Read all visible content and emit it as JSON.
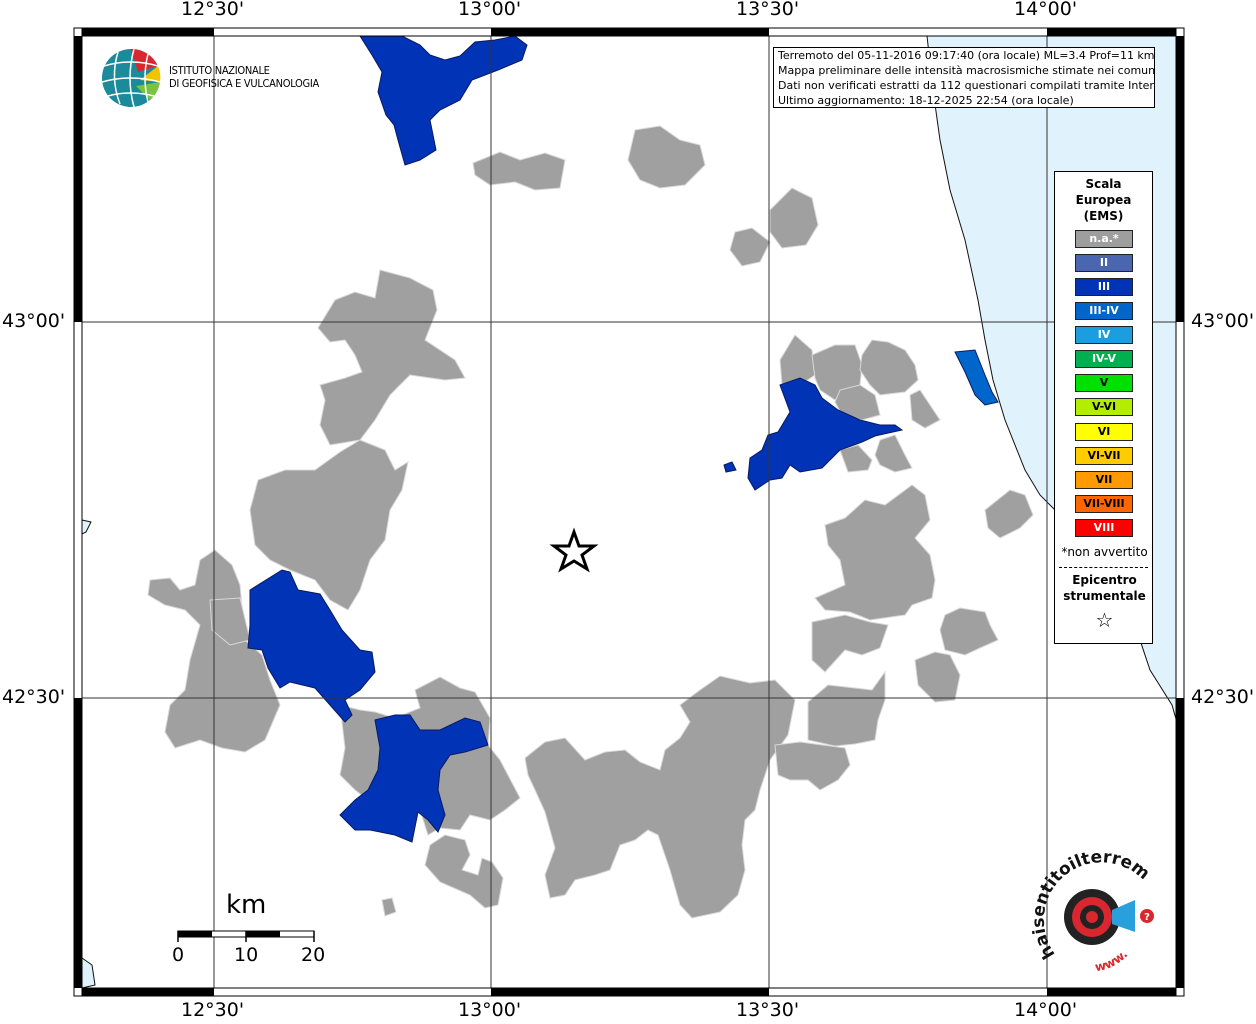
{
  "map": {
    "ticks_top": [
      "12°30'",
      "13°00'",
      "13°30'",
      "14°00'"
    ],
    "ticks_bottom": [
      "12°30'",
      "13°00'",
      "13°30'",
      "14°00'"
    ],
    "ticks_left": [
      "43°00'",
      "42°30'"
    ],
    "ticks_right": [
      "43°00'",
      "42°30'"
    ],
    "info_lines": [
      "Terremoto del 05-11-2016 09:17:40 (ora locale) ML=3.4 Prof=11 km",
      "Mappa preliminare delle intensità macrosismiche stimate nei comuni",
      "Dati non verificati estratti da 112 questionari compilati tramite Internet.",
      "Ultimo aggiornamento: 18-12-2025 22:54 (ora locale)"
    ],
    "logo_lines": [
      "ISTITUTO NAZIONALE",
      "DI GEOFISICA E VULCANOLOGIA"
    ],
    "legend": {
      "title_lines": [
        "Scala",
        "Europea",
        "(EMS)"
      ],
      "classes": [
        {
          "label": "n.a.*",
          "color": "#9e9e9e",
          "text": "#ffffff"
        },
        {
          "label": "II",
          "color": "#4a66b0",
          "text": "#ffffff"
        },
        {
          "label": "III",
          "color": "#0033b5",
          "text": "#ffffff"
        },
        {
          "label": "III-IV",
          "color": "#0066cc",
          "text": "#ffffff"
        },
        {
          "label": "IV",
          "color": "#1a9ee0",
          "text": "#ffffff"
        },
        {
          "label": "IV-V",
          "color": "#00b050",
          "text": "#ffffff"
        },
        {
          "label": "V",
          "color": "#00e000",
          "text": "#000000"
        },
        {
          "label": "V-VI",
          "color": "#b3ee00",
          "text": "#000000"
        },
        {
          "label": "VI",
          "color": "#ffff00",
          "text": "#000000"
        },
        {
          "label": "VI-VII",
          "color": "#ffcc00",
          "text": "#000000"
        },
        {
          "label": "VII",
          "color": "#ff9900",
          "text": "#000000"
        },
        {
          "label": "VII-VIII",
          "color": "#ff6600",
          "text": "#000000"
        },
        {
          "label": "VIII",
          "color": "#ff0000",
          "text": "#ffffff"
        }
      ],
      "note": "*non avvertito",
      "epicenter_lines": [
        "Epicentro",
        "strumentale"
      ],
      "epicenter_symbol": "☆"
    },
    "scale": {
      "unit": "km",
      "labels": [
        "0",
        "10",
        "20"
      ]
    },
    "watermark_text": "haisentitoilterremoto.it",
    "watermark_prefix": "www.",
    "colors": {
      "gray": "#a0a0a0",
      "blue": "#0033b5",
      "mid_blue": "#0066cc",
      "sea": "#e0f2fc"
    }
  }
}
